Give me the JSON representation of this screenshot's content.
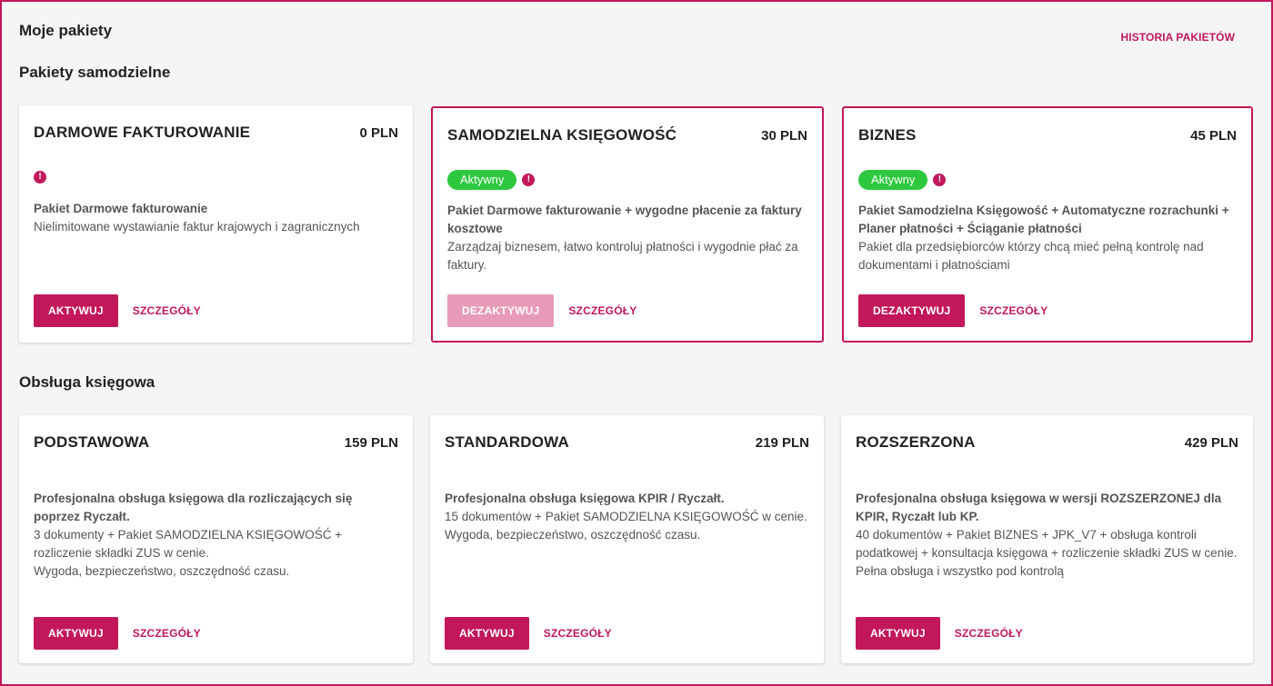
{
  "header": {
    "title": "Moje pakiety",
    "history_link": "HISTORIA PAKIETÓW"
  },
  "sections": [
    {
      "title": "Pakiety samodzielne",
      "cards": [
        {
          "name": "DARMOWE FAKTUROWANIE",
          "price": "0 PLN",
          "status": "",
          "desc_bold": "Pakiet Darmowe fakturowanie",
          "desc": "Nielimitowane wystawianie faktur krajowych i zagranicznych",
          "primary_button": "AKTYWUJ",
          "details_link": "SZCZEGÓŁY"
        },
        {
          "name": "SAMODZIELNA KSIĘGOWOŚĆ",
          "price": "30 PLN",
          "status": "Aktywny",
          "desc_bold": "Pakiet Darmowe fakturowanie + wygodne płacenie za faktury kosztowe",
          "desc": "Zarządzaj biznesem, łatwo kontroluj płatności i wygodnie płać za faktury.",
          "primary_button": "DEZAKTYWUJ",
          "details_link": "SZCZEGÓŁY"
        },
        {
          "name": "BIZNES",
          "price": "45 PLN",
          "status": "Aktywny",
          "desc_bold": "Pakiet Samodzielna Księgowość + Automatyczne rozrachunki + Planer płatności + Ściąganie płatności",
          "desc": "Pakiet dla przedsiębiorców którzy chcą mieć pełną kontrolę nad dokumentami i płatnościami",
          "primary_button": "DEZAKTYWUJ",
          "details_link": "SZCZEGÓŁY"
        }
      ]
    },
    {
      "title": "Obsługa księgowa",
      "cards": [
        {
          "name": "PODSTAWOWA",
          "price": "159 PLN",
          "desc_bold": "Profesjonalna obsługa księgowa dla rozliczających się poprzez Ryczałt.",
          "desc_lines": [
            "3 dokumenty + Pakiet SAMODZIELNA KSIĘGOWOŚĆ + rozliczenie składki ZUS w cenie.",
            "Wygoda, bezpieczeństwo, oszczędność czasu."
          ],
          "primary_button": "AKTYWUJ",
          "details_link": "SZCZEGÓŁY"
        },
        {
          "name": "STANDARDOWA",
          "price": "219 PLN",
          "desc_bold": "Profesjonalna obsługa księgowa KPIR / Ryczałt.",
          "desc_lines": [
            "15 dokumentów + Pakiet SAMODZIELNA KSIĘGOWOŚĆ w cenie.",
            "Wygoda, bezpieczeństwo, oszczędność czasu."
          ],
          "primary_button": "AKTYWUJ",
          "details_link": "SZCZEGÓŁY"
        },
        {
          "name": "ROZSZERZONA",
          "price": "429 PLN",
          "desc_bold": "Profesjonalna obsługa księgowa w wersji ROZSZERZONEJ dla KPIR, Ryczałt lub KP.",
          "desc_lines": [
            "40 dokumentów + Pakiet BIZNES + JPK_V7 + obsługa kontroli podatkowej + konsultacja księgowa + rozliczenie składki ZUS w cenie.",
            "Pełna obsługa i wszystko pod kontrolą"
          ],
          "primary_button": "AKTYWUJ",
          "details_link": "SZCZEGÓŁY"
        }
      ]
    }
  ],
  "colors": {
    "accent": "#c2185b",
    "accent_disabled": "#e89bb8",
    "active_badge": "#2ec83f"
  },
  "icons": {
    "alert": "exclamation-circle-icon"
  }
}
